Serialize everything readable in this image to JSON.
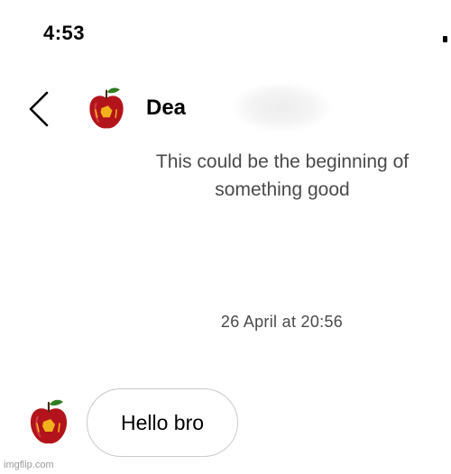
{
  "status_bar": {
    "time": "4:53"
  },
  "header": {
    "back_icon": "chevron-left-icon",
    "avatar_icon": "apple-avatar",
    "contact_name": "Dea"
  },
  "intro": {
    "text": "This could be the beginning of something good"
  },
  "conversation": {
    "timestamp": "26 April at 20:56",
    "messages": [
      {
        "sender": "Dea",
        "avatar_icon": "apple-avatar",
        "text": "Hello bro"
      }
    ]
  },
  "watermark": {
    "text": "imgflip.com"
  },
  "colors": {
    "apple_red": "#b3141b",
    "apple_leaf": "#2f7d1f",
    "secondary_text": "#4a4a4a",
    "bubble_border": "#c9c9c9"
  }
}
